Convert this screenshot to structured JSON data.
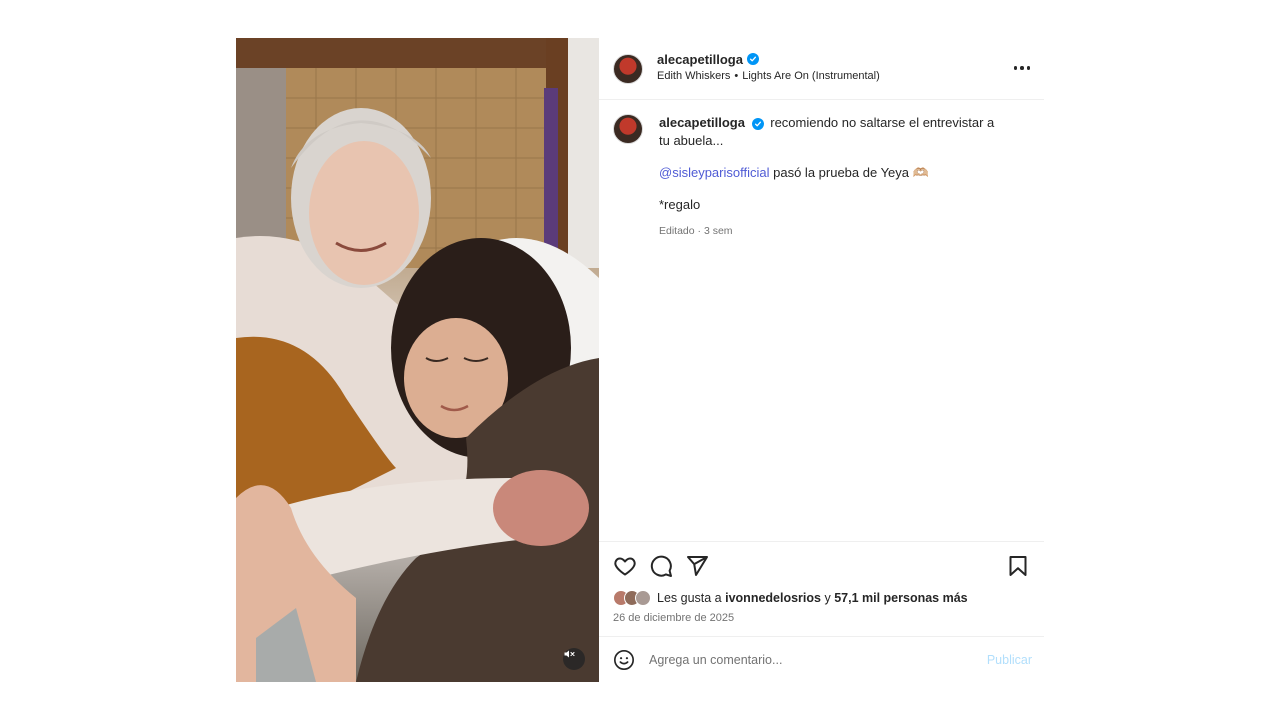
{
  "post": {
    "author": {
      "username": "alecapetilloga",
      "verified": true
    },
    "audio": {
      "artist": "Edith Whiskers",
      "separator": "•",
      "track": "Lights Are On (Instrumental)"
    },
    "caption": {
      "text": "recomiendo no saltarse el entrevistar a tu abuela...",
      "mention": "@sisleyparisofficial",
      "mention_text": "pasó la prueba de Yeya 🫶🏼",
      "line3": "*regalo",
      "edited": "Editado · 3 sem"
    },
    "likes": {
      "prefix": "Les gusta a",
      "user": "ivonnedelosrios",
      "and": "y",
      "count": "57,1 mil personas más"
    },
    "date": "26 de diciembre de 2025",
    "comment": {
      "placeholder": "Agrega un comentario...",
      "publish_label": "Publicar"
    },
    "media": {
      "muted": true
    }
  },
  "colors": {
    "verified": "#0095f6",
    "mention": "#4f5bd5",
    "publish_disabled": "#b2dffc",
    "secondary_text": "#737373"
  },
  "icons": [
    "verified-icon",
    "more-options-icon",
    "heart-icon",
    "comment-icon",
    "share-icon",
    "bookmark-icon",
    "emoji-icon",
    "mute-icon"
  ]
}
